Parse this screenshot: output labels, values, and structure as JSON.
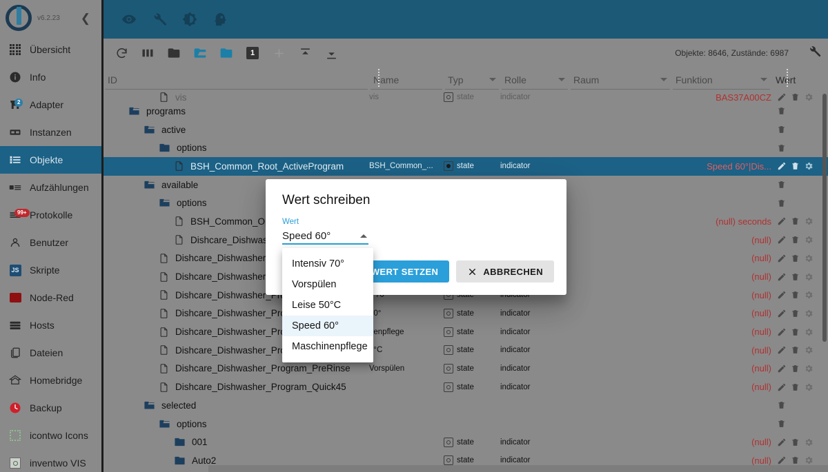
{
  "sidebar": {
    "version": "v6.2.23",
    "collapse_icon": "chevron-left-icon",
    "items": [
      {
        "label": "Übersicht",
        "icon": "grid-icon",
        "badge": null,
        "active": false
      },
      {
        "label": "Info",
        "icon": "info-icon",
        "badge": null,
        "active": false
      },
      {
        "label": "Adapter",
        "icon": "store-icon",
        "badge": "2",
        "badge_color": "#2b7fa8",
        "active": false
      },
      {
        "label": "Instanzen",
        "icon": "instances-icon",
        "badge": null,
        "active": false
      },
      {
        "label": "Objekte",
        "icon": "list-icon",
        "badge": null,
        "active": true
      },
      {
        "label": "Aufzählungen",
        "icon": "enums-icon",
        "badge": null,
        "active": false
      },
      {
        "label": "Protokolle",
        "icon": "logs-icon",
        "badge": "99+",
        "badge_color": "#c0272d",
        "active": false
      },
      {
        "label": "Benutzer",
        "icon": "user-icon",
        "badge": null,
        "active": false
      },
      {
        "label": "Skripte",
        "icon": "js-icon",
        "badge": null,
        "active": false
      },
      {
        "label": "Node-Red",
        "icon": "node-red-icon",
        "badge": null,
        "active": false
      },
      {
        "label": "Hosts",
        "icon": "hosts-icon",
        "badge": null,
        "active": false
      },
      {
        "label": "Dateien",
        "icon": "files-icon",
        "badge": null,
        "active": false
      },
      {
        "label": "Homebridge",
        "icon": "homebridge-icon",
        "badge": null,
        "active": false
      },
      {
        "label": "Backup",
        "icon": "backup-icon",
        "badge": null,
        "active": false
      },
      {
        "label": "icontwo Icons",
        "icon": "icontwo-icon",
        "badge": null,
        "active": false
      },
      {
        "label": "inventwo VIS",
        "icon": "inventwo-icon",
        "badge": null,
        "active": false
      }
    ]
  },
  "appbar": {
    "background": "#1b5977",
    "icons": [
      "eye-icon",
      "wrench-icon",
      "brightness-icon",
      "expert-head-icon"
    ]
  },
  "table_toolbar": {
    "icons": [
      "refresh-icon",
      "columns-icon",
      "collapse-all-icon",
      "expand-all-icon",
      "expand-one-icon",
      "depth-1-icon",
      "add-icon",
      "import-icon",
      "export-icon"
    ],
    "depth_label": "1",
    "stats": "Objekte: 8646, Zustände: 6987",
    "settings_icon": "wrench-icon"
  },
  "columns": [
    {
      "key": "id",
      "label": "ID",
      "filterable": false
    },
    {
      "key": "name",
      "label": "Name",
      "filterable": false
    },
    {
      "key": "typ",
      "label": "Typ",
      "filterable": true
    },
    {
      "key": "rolle",
      "label": "Rolle",
      "filterable": true
    },
    {
      "key": "raum",
      "label": "Raum",
      "filterable": true
    },
    {
      "key": "funktion",
      "label": "Funktion",
      "filterable": true
    },
    {
      "key": "wert",
      "label": "Wert",
      "filterable": false
    }
  ],
  "rows": [
    {
      "kind": "partial",
      "indent": 3,
      "icon": "file-icon",
      "id": "vis",
      "name": "vis",
      "typ": "state",
      "rolle": "indicator",
      "wert": "BAS37A00CZ",
      "actions": [
        "edit-icon",
        "delete-icon",
        "settings-icon"
      ]
    },
    {
      "kind": "folder-open",
      "indent": 1,
      "icon": "folder-open-icon",
      "id": "programs",
      "name": "",
      "typ": "",
      "rolle": "",
      "wert": "",
      "actions": [
        "delete-icon"
      ]
    },
    {
      "kind": "folder-open",
      "indent": 2,
      "icon": "folder-open-icon",
      "id": "active",
      "name": "",
      "typ": "",
      "rolle": "",
      "wert": "",
      "actions": [
        "delete-icon"
      ]
    },
    {
      "kind": "folder-closed",
      "indent": 3,
      "icon": "folder-closed-icon",
      "id": "options",
      "name": "",
      "typ": "",
      "rolle": "",
      "wert": "",
      "actions": [
        "delete-icon"
      ]
    },
    {
      "kind": "state",
      "selected": true,
      "indent": 4,
      "icon": "file-icon",
      "id": "BSH_Common_Root_ActiveProgram",
      "name": "BSH_Common_...",
      "typ": "state",
      "rolle": "indicator",
      "wert": "Speed 60°|Dis...",
      "actions": [
        "edit-icon",
        "delete-icon",
        "settings-icon"
      ]
    },
    {
      "kind": "folder-open",
      "indent": 2,
      "icon": "folder-open-icon",
      "id": "available",
      "name": "",
      "typ": "",
      "rolle": "",
      "wert": "",
      "actions": [
        "delete-icon"
      ]
    },
    {
      "kind": "folder-open",
      "indent": 3,
      "icon": "folder-open-icon",
      "id": "options",
      "name": "",
      "typ": "",
      "rolle": "",
      "wert": "",
      "actions": [
        "delete-icon"
      ]
    },
    {
      "kind": "state",
      "indent": 4,
      "icon": "file-icon",
      "id": "BSH_Common_Optio",
      "name": "",
      "typ": "state",
      "rolle": "indicator",
      "wert": "(null) seconds",
      "actions": [
        "edit-icon",
        "delete-icon",
        "settings-icon"
      ]
    },
    {
      "kind": "state",
      "indent": 4,
      "icon": "file-icon",
      "id": "Dishcare_Dishwashe",
      "name": "",
      "typ": "state",
      "rolle": "indicator",
      "wert": "(null)",
      "actions": [
        "edit-icon",
        "delete-icon",
        "settings-icon"
      ]
    },
    {
      "kind": "state",
      "indent": 3,
      "icon": "file-icon",
      "id": "Dishcare_Dishwasher_",
      "name": "",
      "typ": "state",
      "rolle": "indicator",
      "wert": "(null)",
      "actions": [
        "edit-icon",
        "delete-icon",
        "settings-icon"
      ]
    },
    {
      "kind": "state",
      "indent": 3,
      "icon": "file-icon",
      "id": "Dishcare_Dishwasher_",
      "name": "",
      "typ": "state",
      "rolle": "indicator",
      "wert": "(null)",
      "actions": [
        "edit-icon",
        "delete-icon",
        "settings-icon"
      ]
    },
    {
      "kind": "state",
      "indent": 3,
      "icon": "file-icon",
      "id": "Dishcare_Dishwasher_Pro",
      "name": "v 70°",
      "typ": "state",
      "rolle": "indicator",
      "wert": "(null)",
      "actions": [
        "edit-icon",
        "delete-icon",
        "settings-icon"
      ]
    },
    {
      "kind": "state",
      "indent": 3,
      "icon": "file-icon",
      "id": "Dishcare_Dishwasher_Pro",
      "name": "60°",
      "typ": "state",
      "rolle": "indicator",
      "wert": "(null)",
      "actions": [
        "edit-icon",
        "delete-icon",
        "settings-icon"
      ]
    },
    {
      "kind": "state",
      "indent": 3,
      "icon": "file-icon",
      "id": "Dishcare_Dishwasher_Pro",
      "name": "nenpflege",
      "typ": "state",
      "rolle": "indicator",
      "wert": "(null)",
      "actions": [
        "edit-icon",
        "delete-icon",
        "settings-icon"
      ]
    },
    {
      "kind": "state",
      "indent": 3,
      "icon": "file-icon",
      "id": "Dishcare_Dishwasher_Pro",
      "name": "0°C",
      "typ": "state",
      "rolle": "indicator",
      "wert": "(null)",
      "actions": [
        "edit-icon",
        "delete-icon",
        "settings-icon"
      ]
    },
    {
      "kind": "state",
      "indent": 3,
      "icon": "file-icon",
      "id": "Dishcare_Dishwasher_Program_PreRinse",
      "name": "Vorspülen",
      "typ": "state",
      "rolle": "indicator",
      "wert": "(null)",
      "actions": [
        "edit-icon",
        "delete-icon",
        "settings-icon"
      ]
    },
    {
      "kind": "state",
      "indent": 3,
      "icon": "file-icon",
      "id": "Dishcare_Dishwasher_Program_Quick45",
      "name": "",
      "typ": "state",
      "rolle": "indicator",
      "wert": "(null)",
      "actions": [
        "edit-icon",
        "delete-icon",
        "settings-icon"
      ]
    },
    {
      "kind": "folder-open",
      "indent": 2,
      "icon": "folder-open-icon",
      "id": "selected",
      "name": "",
      "typ": "",
      "rolle": "",
      "wert": "",
      "actions": [
        "delete-icon"
      ]
    },
    {
      "kind": "folder-open",
      "indent": 3,
      "icon": "folder-open-icon",
      "id": "options",
      "name": "",
      "typ": "",
      "rolle": "",
      "wert": "",
      "actions": [
        "delete-icon"
      ]
    },
    {
      "kind": "folder-closed",
      "indent": 4,
      "icon": "folder-closed-icon",
      "id": "001",
      "name": "",
      "typ": "state",
      "rolle": "indicator",
      "wert": "(null)",
      "actions": [
        "edit-icon",
        "delete-icon",
        "settings-icon"
      ]
    },
    {
      "kind": "folder-closed",
      "indent": 4,
      "icon": "folder-closed-icon",
      "id": "Auto2",
      "name": "",
      "typ": "state",
      "rolle": "indicator",
      "wert": "(null)",
      "actions": [
        "edit-icon",
        "delete-icon",
        "settings-icon"
      ]
    }
  ],
  "dialog": {
    "title": "Wert schreiben",
    "field_label": "Wert",
    "selected_value": "Speed 60°",
    "dropdown_caret": "caret-up-icon",
    "confirm_label": "WERT SETZEN",
    "confirm_icon": "check-icon",
    "cancel_label": "ABBRECHEN",
    "cancel_icon": "close-icon",
    "primary_color": "#2b9fd9",
    "options": [
      {
        "label": "Intensiv 70°",
        "selected": false
      },
      {
        "label": "Vorspülen",
        "selected": false
      },
      {
        "label": "Leise 50°C",
        "selected": false
      },
      {
        "label": "Speed 60°",
        "selected": true
      },
      {
        "label": "Maschinenpflege",
        "selected": false
      }
    ]
  }
}
